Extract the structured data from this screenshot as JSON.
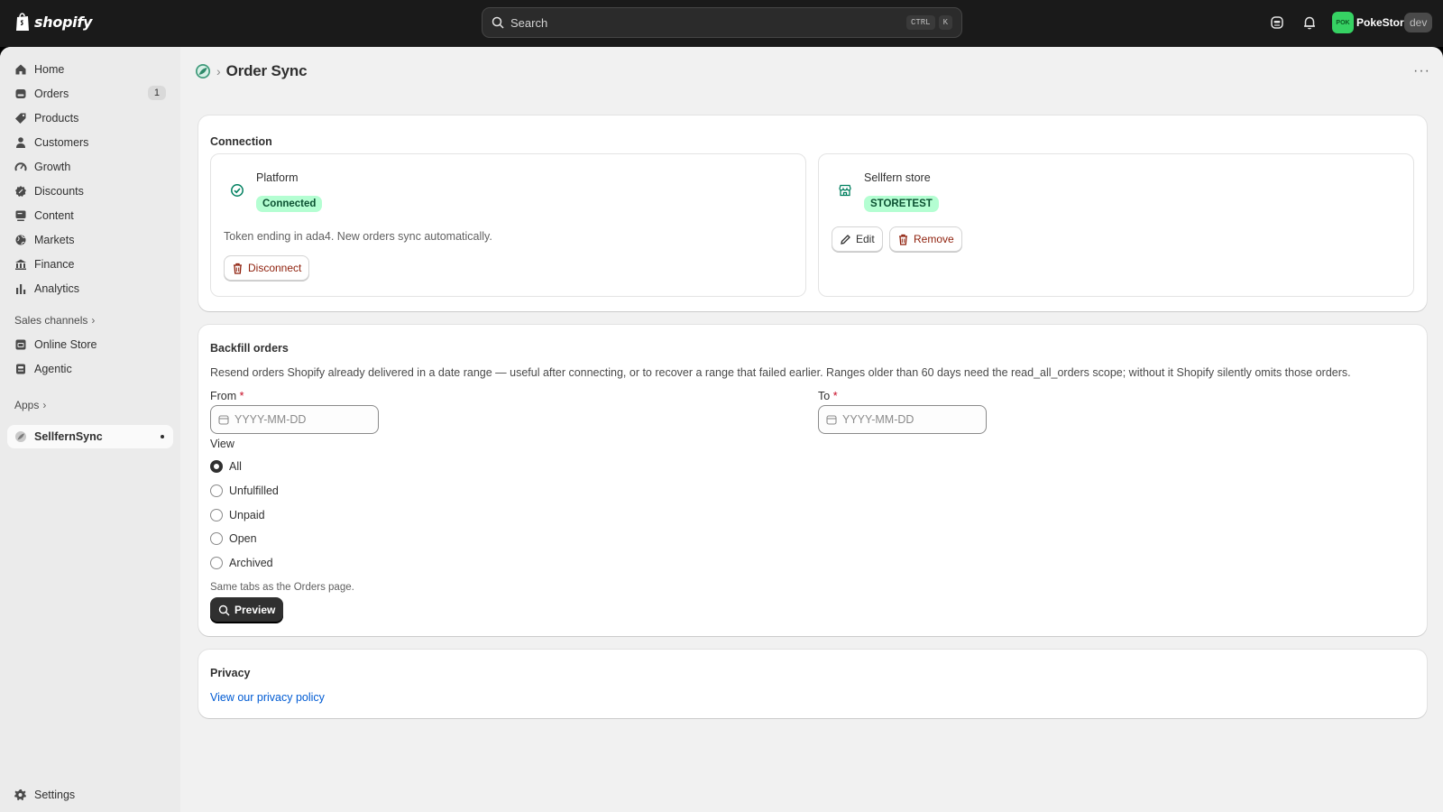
{
  "topbar": {
    "logo_text": "shopify",
    "search_placeholder": "Search",
    "shortcut_keys": [
      "CTRL",
      "K"
    ],
    "store_initials": "POK",
    "store_name": "PokeStore",
    "store_badge": "dev",
    "icons": [
      "sidekick-icon",
      "bell-icon"
    ]
  },
  "sidebar": {
    "items": [
      {
        "label": "Home",
        "icon": "home-icon"
      },
      {
        "label": "Orders",
        "icon": "orders-icon",
        "count": "1"
      },
      {
        "label": "Products",
        "icon": "tag-icon"
      },
      {
        "label": "Customers",
        "icon": "person-icon"
      },
      {
        "label": "Growth",
        "icon": "gauge-icon"
      },
      {
        "label": "Discounts",
        "icon": "discount-icon"
      },
      {
        "label": "Content",
        "icon": "content-icon"
      },
      {
        "label": "Markets",
        "icon": "globe-icon"
      },
      {
        "label": "Finance",
        "icon": "bank-icon"
      },
      {
        "label": "Analytics",
        "icon": "bar-chart-icon"
      }
    ],
    "sales_channels_label": "Sales channels",
    "channels": [
      {
        "label": "Online Store",
        "icon": "store-icon"
      },
      {
        "label": "Agentic",
        "icon": "agentic-icon"
      }
    ],
    "apps_label": "Apps",
    "apps": [
      {
        "label": "SellfernSync",
        "icon": "app-icon"
      }
    ],
    "settings_label": "Settings"
  },
  "page": {
    "title": "Order Sync",
    "more_label": "···"
  },
  "connection": {
    "title": "Connection",
    "platform": {
      "title": "Platform",
      "status": "Connected",
      "description": "Token ending in ada4. New orders sync automatically.",
      "disconnect_label": "Disconnect"
    },
    "store": {
      "title": "Sellfern store",
      "store_code": "STORETEST",
      "edit_label": "Edit",
      "remove_label": "Remove"
    }
  },
  "backfill": {
    "title": "Backfill orders",
    "description": "Resend orders Shopify already delivered in a date range — useful after connecting, or to recover a range that failed earlier. Ranges older than 60 days need the read_all_orders scope; without it Shopify silently omits those orders.",
    "from_label": "From",
    "to_label": "To",
    "required_mark": "*",
    "date_placeholder": "YYYY-MM-DD",
    "view_label": "View",
    "view_options": [
      "All",
      "Unfulfilled",
      "Unpaid",
      "Open",
      "Archived"
    ],
    "selected_view": "All",
    "help_text": "Same tabs as the Orders page.",
    "preview_label": "Preview"
  },
  "privacy": {
    "title": "Privacy",
    "link_label": "View our privacy policy"
  },
  "colors": {
    "topbar": "#1a1a1a",
    "success_badge": "#b4fed2",
    "critical": "#8e1f0b",
    "link": "#005bd3",
    "primary": "#303030"
  }
}
